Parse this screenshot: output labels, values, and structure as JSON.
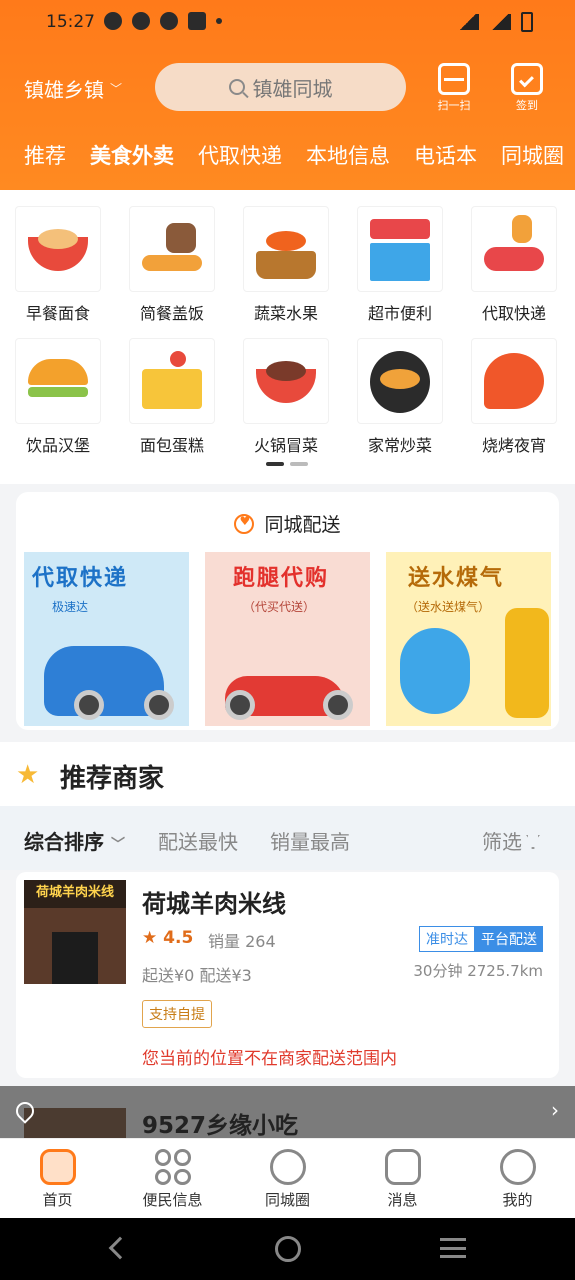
{
  "status_bar": {
    "time": "15:27"
  },
  "header": {
    "location": "镇雄乡镇",
    "search_placeholder": "镇雄同城",
    "scan_label": "扫一扫",
    "sign_label": "签到",
    "tabs": [
      "推荐",
      "美食外卖",
      "代取快递",
      "本地信息",
      "电话本",
      "同城圈"
    ],
    "active_tab": "美食外卖",
    "accent_color": "#ff7a1a"
  },
  "categories": [
    {
      "label": "早餐面食",
      "icon": "noodle-bowl-icon"
    },
    {
      "label": "简餐盖饭",
      "icon": "rice-meal-icon"
    },
    {
      "label": "蔬菜水果",
      "icon": "fruit-basket-icon"
    },
    {
      "label": "超市便利",
      "icon": "store-icon"
    },
    {
      "label": "代取快递",
      "icon": "delivery-scooter-icon"
    },
    {
      "label": "饮品汉堡",
      "icon": "burger-icon"
    },
    {
      "label": "面包蛋糕",
      "icon": "cake-icon"
    },
    {
      "label": "火锅冒菜",
      "icon": "hotpot-icon"
    },
    {
      "label": "家常炒菜",
      "icon": "stir-fry-icon"
    },
    {
      "label": "烧烤夜宵",
      "icon": "shrimp-icon"
    }
  ],
  "delivery": {
    "title": "同城配送",
    "banners": [
      {
        "title": "代取快递",
        "subtitle": "极速达"
      },
      {
        "title": "跑腿代购",
        "subtitle": "（代买代送）"
      },
      {
        "title": "送水煤气",
        "subtitle": "（送水送煤气）"
      }
    ]
  },
  "recommend": {
    "title": "推荐商家"
  },
  "sort": {
    "options": [
      "综合排序",
      "配送最快",
      "销量最高"
    ],
    "filter": "筛选"
  },
  "shops": [
    {
      "name": "荷城羊肉米线",
      "sign_text": "荷城羊肉米线",
      "rating": "4.5",
      "sales": "销量 264",
      "fees": "起送¥0  配送¥3",
      "tag_on_time": "准时达",
      "tag_platform": "平台配送",
      "eta": "30分钟 2725.7km",
      "pickup": "支持自提",
      "warning": "您当前的位置不在商家配送范围内"
    },
    {
      "name": "9527乡缘小吃"
    }
  ],
  "bottom_nav": [
    {
      "label": "首页",
      "icon": "home-icon"
    },
    {
      "label": "便民信息",
      "icon": "grid-icon"
    },
    {
      "label": "同城圈",
      "icon": "smile-icon"
    },
    {
      "label": "消息",
      "icon": "message-icon"
    },
    {
      "label": "我的",
      "icon": "user-icon"
    }
  ]
}
